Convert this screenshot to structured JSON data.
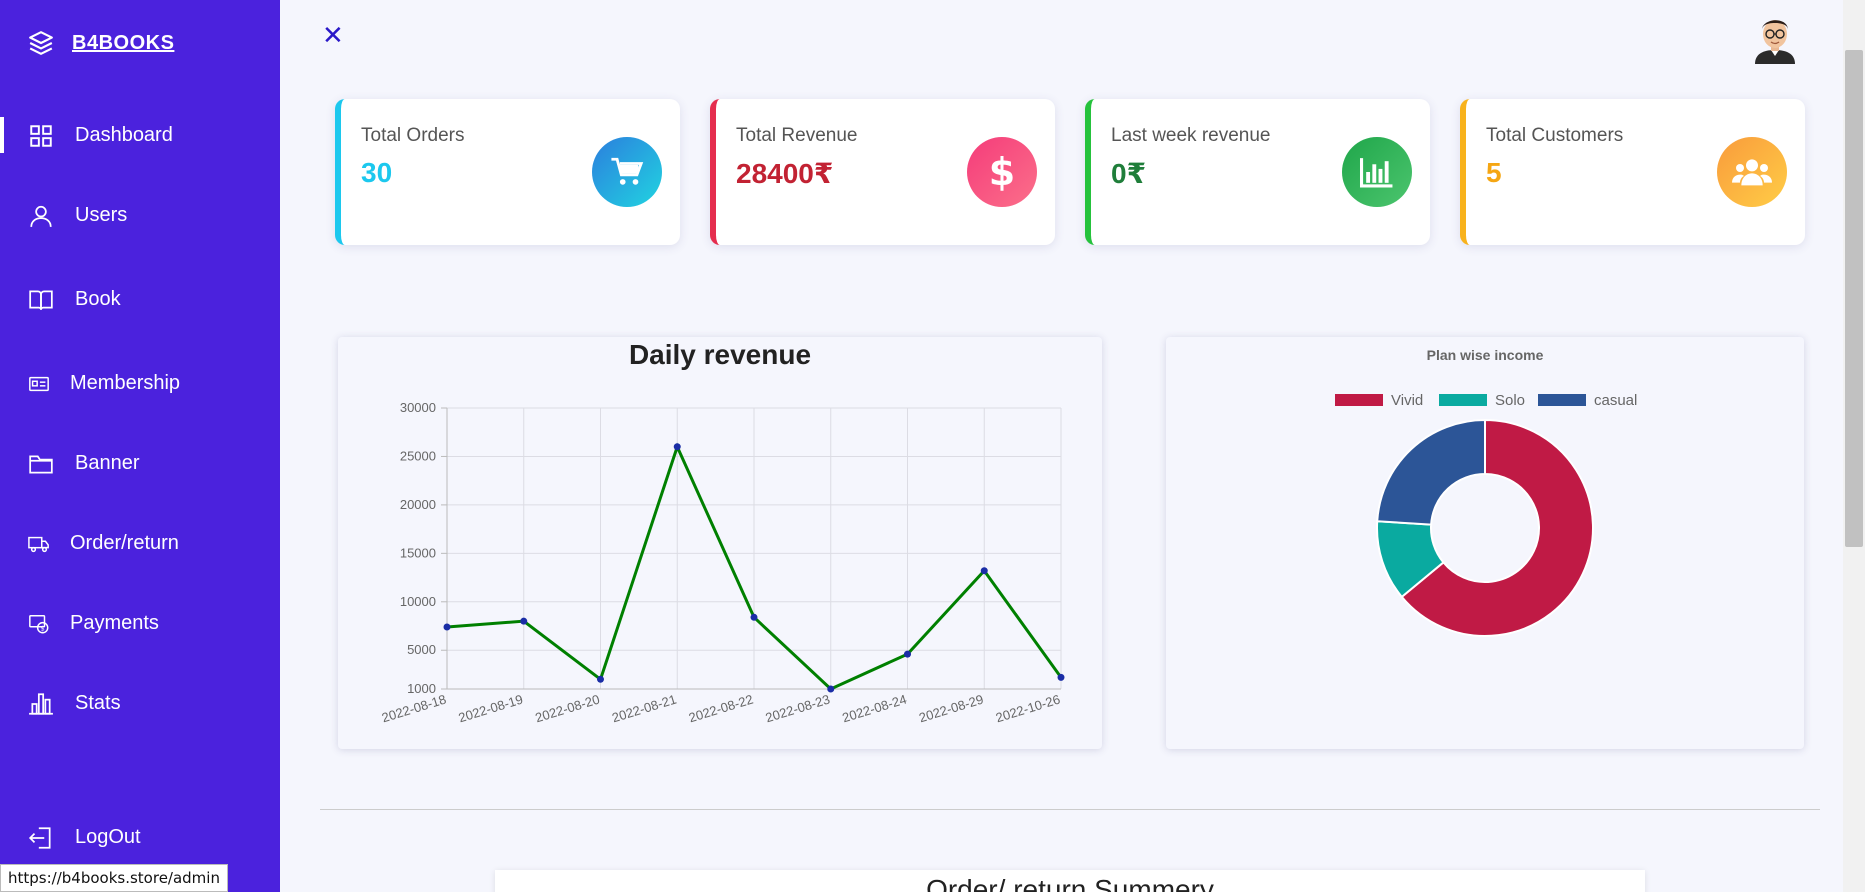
{
  "brand": {
    "name": "B4BOOKS",
    "icon": "layers-icon"
  },
  "sidebar": {
    "items": [
      {
        "label": "Dashboard",
        "icon": "grid-icon"
      },
      {
        "label": "Users",
        "icon": "user-icon"
      },
      {
        "label": "Book",
        "icon": "book-icon"
      },
      {
        "label": "Membership",
        "icon": "card-icon"
      },
      {
        "label": "Banner",
        "icon": "folder-icon"
      },
      {
        "label": "Order/return",
        "icon": "truck-icon"
      },
      {
        "label": "Payments",
        "icon": "payments-icon"
      },
      {
        "label": "Stats",
        "icon": "bar-chart-icon"
      }
    ],
    "logout": {
      "label": "LogOut",
      "icon": "logout-icon"
    }
  },
  "header": {
    "close_icon": "close-icon"
  },
  "stats": [
    {
      "title": "Total Orders",
      "value": "30",
      "color": "#1cc8ee",
      "icon": "cart-icon"
    },
    {
      "title": "Total Revenue",
      "value": "28400₹",
      "color": "#e52d4e",
      "icon": "dollar-icon"
    },
    {
      "title": "Last week revenue",
      "value": "0₹",
      "color": "#25c23c",
      "icon": "bar-chart-icon"
    },
    {
      "title": "Total Customers",
      "value": "5",
      "color": "#f8b21c",
      "icon": "users-icon"
    }
  ],
  "chart_data": [
    {
      "type": "line",
      "title": "Daily revenue",
      "categories": [
        "2022-08-18",
        "2022-08-19",
        "2022-08-20",
        "2022-08-21",
        "2022-08-22",
        "2022-08-23",
        "2022-08-24",
        "2022-08-29",
        "2022-10-26"
      ],
      "series": [
        {
          "values": [
            7400,
            8000,
            2000,
            26000,
            8400,
            1000,
            4600,
            13200,
            2200
          ],
          "color": "#008000"
        }
      ],
      "yticks": [
        "30000",
        "25000",
        "20000",
        "15000",
        "10000",
        "5000",
        "1000"
      ],
      "ylim": [
        1000,
        30000
      ],
      "grid": true
    },
    {
      "type": "pie",
      "title": "Plan wise income",
      "legend_position": "top",
      "labels": [
        "Vivid",
        "Solo",
        "casual"
      ],
      "values": [
        64,
        12,
        24
      ],
      "colors": [
        "#c01a45",
        "#0aaaa0",
        "#2c5597"
      ]
    }
  ],
  "summary": {
    "title": "Order/ return Summery"
  },
  "status_url": "https://b4books.store/admin"
}
